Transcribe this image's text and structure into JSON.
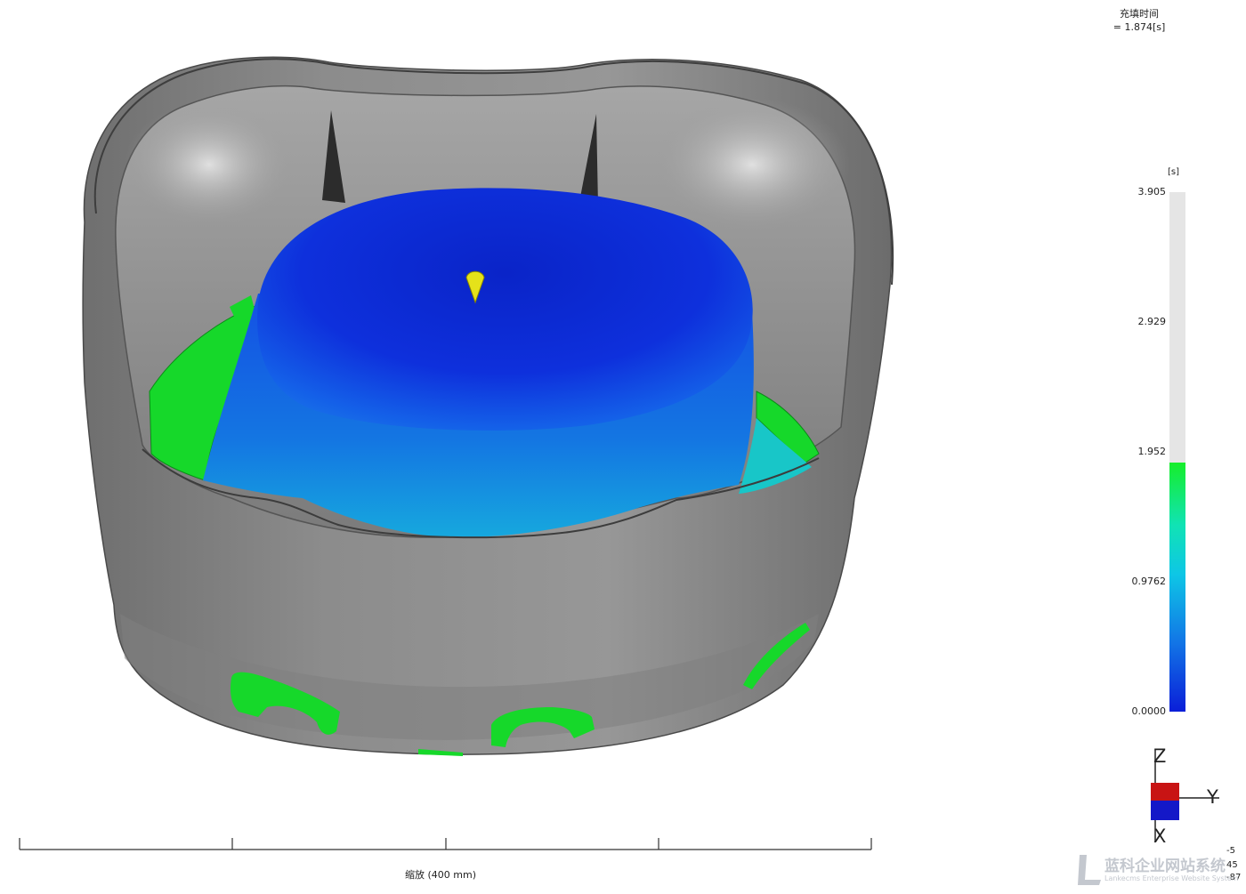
{
  "result": {
    "title": "充填时间",
    "value": "= 1.874[s]"
  },
  "legend": {
    "unit": "[s]",
    "ticks": [
      "3.905",
      "2.929",
      "1.952",
      "0.9762",
      "0.0000"
    ],
    "current_fill_fraction": 0.48,
    "colors": {
      "high": "#16ee2a",
      "mid": "#0ec6e6",
      "low": "#0a1ed8",
      "unfilled": "#e5e5e5"
    }
  },
  "triad": {
    "z_label": "Z",
    "y_label": "Y",
    "x_label": "X",
    "angle_1": "-5",
    "angle_2": "45",
    "angle_3": "-87"
  },
  "scale": {
    "label": "缩放 (400 mm)"
  },
  "watermark": {
    "text": "蓝科企业网站系统",
    "subtext": "Lankecms Enterprise Website System"
  },
  "model": {
    "part_color": "#8a8a8a",
    "melt_front_colors": [
      "#0a1ed8",
      "#1276e6",
      "#10c8d6",
      "#16ee2a"
    ],
    "gate_color": "#e5e21a"
  }
}
